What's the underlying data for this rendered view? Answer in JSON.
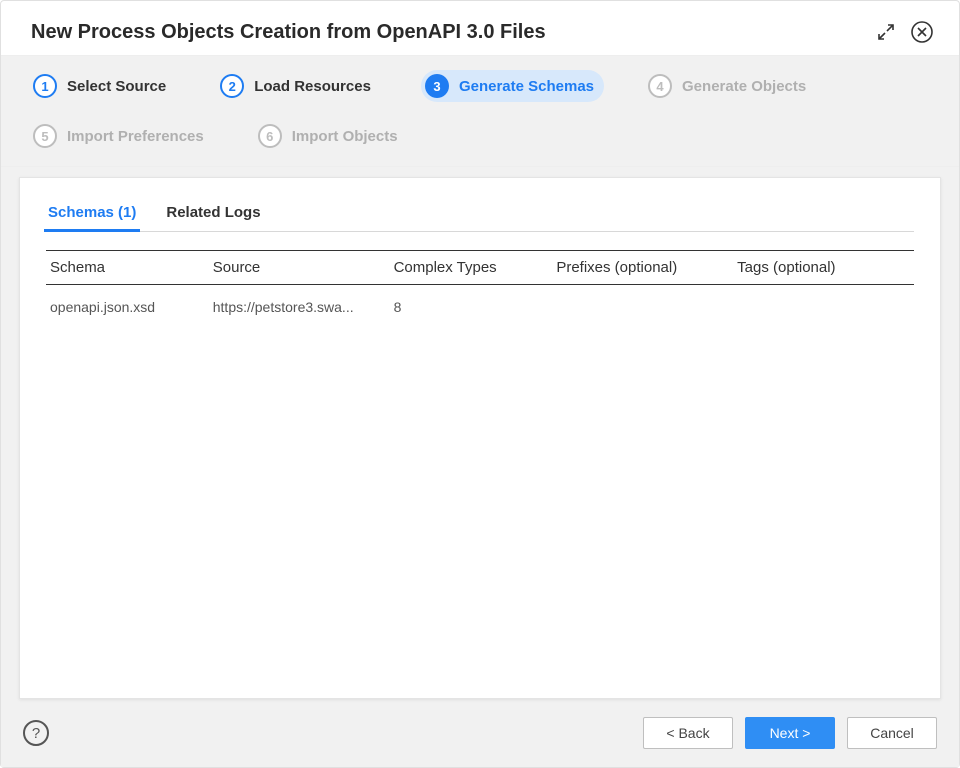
{
  "header": {
    "title": "New Process Objects Creation from OpenAPI 3.0 Files"
  },
  "steps": [
    {
      "num": "1",
      "label": "Select Source",
      "state": "done"
    },
    {
      "num": "2",
      "label": "Load Resources",
      "state": "done"
    },
    {
      "num": "3",
      "label": "Generate Schemas",
      "state": "current"
    },
    {
      "num": "4",
      "label": "Generate Objects",
      "state": "future"
    },
    {
      "num": "5",
      "label": "Import Preferences",
      "state": "future"
    },
    {
      "num": "6",
      "label": "Import Objects",
      "state": "future"
    }
  ],
  "tabs": {
    "schemas_label": "Schemas (1)",
    "logs_label": "Related Logs",
    "active": "schemas"
  },
  "table": {
    "headers": {
      "schema": "Schema",
      "source": "Source",
      "complex_types": "Complex Types",
      "prefixes": "Prefixes (optional)",
      "tags": "Tags (optional)"
    },
    "rows": [
      {
        "schema": "openapi.json.xsd",
        "source": "https://petstore3.swa...",
        "complex_types": "8",
        "prefixes": "",
        "tags": ""
      }
    ]
  },
  "footer": {
    "back": "< Back",
    "next": "Next >",
    "cancel": "Cancel"
  }
}
